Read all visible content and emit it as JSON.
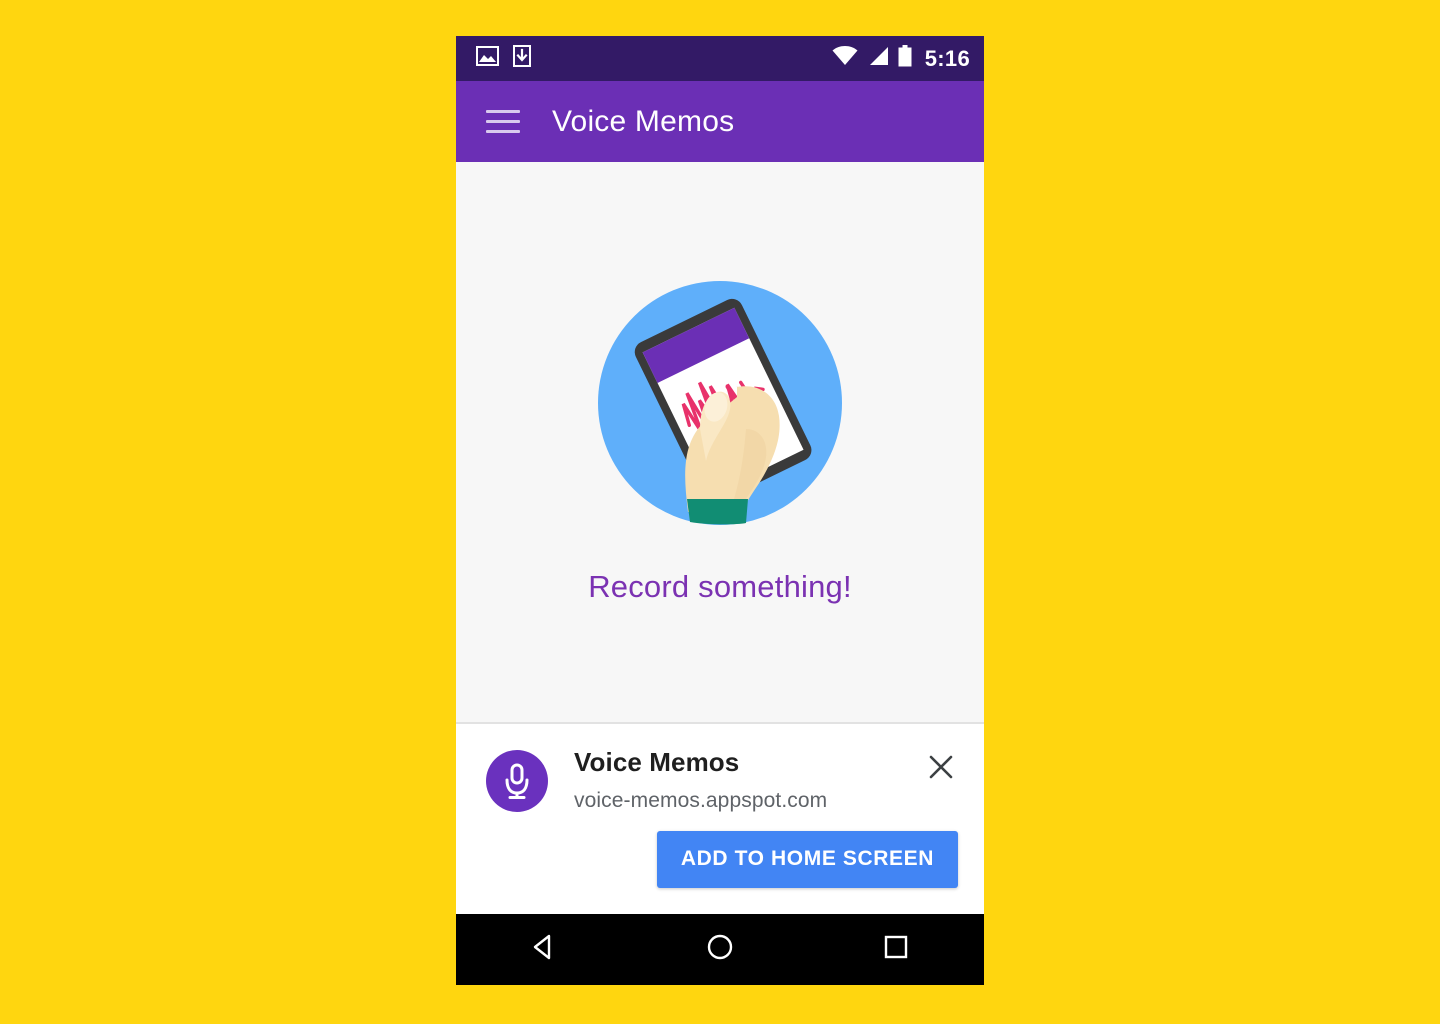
{
  "theme": {
    "backdrop": "#FFD60F",
    "status_bar_bg": "#331A66",
    "toolbar_bg": "#6B2FB5",
    "accent_purple": "#7B32B2",
    "app_icon_bg": "#6A31BE",
    "install_button_bg": "#4285F4",
    "illustration_circle": "#5FAFFA",
    "illustration_waveform": "#E8326B",
    "illustration_sleeve": "#118D73",
    "empty_state_bg": "#F7F7F7",
    "nav_bar_bg": "#000000"
  },
  "status_bar": {
    "time": "5:16",
    "left_icons": [
      {
        "name": "screenshot-image-icon",
        "label": "image"
      },
      {
        "name": "download-icon",
        "label": "download"
      }
    ],
    "right_icons": [
      {
        "name": "wifi-icon",
        "label": "wifi"
      },
      {
        "name": "cellular-signal-icon",
        "label": "signal"
      },
      {
        "name": "battery-icon",
        "label": "battery"
      }
    ]
  },
  "toolbar": {
    "menu_icon": "hamburger-menu-icon",
    "title": "Voice Memos"
  },
  "empty_state": {
    "illustration_name": "hand-holding-phone-recording-illustration",
    "message": "Record something!"
  },
  "install_banner": {
    "app_icon_name": "microphone-icon",
    "title": "Voice Memos",
    "origin": "voice-memos.appspot.com",
    "close_icon": "close-icon",
    "install_label": "ADD TO HOME SCREEN"
  },
  "nav_bar": {
    "buttons": [
      {
        "name": "back-button",
        "icon": "triangle-back-icon"
      },
      {
        "name": "home-button",
        "icon": "circle-home-icon"
      },
      {
        "name": "recents-button",
        "icon": "square-recents-icon"
      }
    ]
  }
}
